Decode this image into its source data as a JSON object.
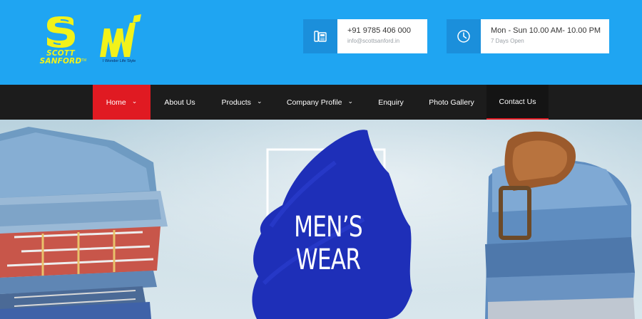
{
  "header": {
    "logo_scott": {
      "line1": "SCOTT",
      "line2": "SANFORD",
      "tm": "TM"
    },
    "logo_mw": {
      "tagline": "I Wonder Life Style"
    },
    "phone": {
      "number": "+91 9785 406 000",
      "email": "info@scottsanford.in",
      "icon": "phone-icon"
    },
    "hours": {
      "time": "Mon - Sun 10.00 AM- 10.00 PM",
      "note": "7 Days Open",
      "icon": "clock-icon"
    }
  },
  "nav": {
    "items": [
      {
        "label": "Home",
        "chev": "⌄"
      },
      {
        "label": "About Us"
      },
      {
        "label": "Products",
        "chev": "⌄"
      },
      {
        "label": "Company Profile",
        "chev": "⌄"
      },
      {
        "label": "Enquiry"
      },
      {
        "label": "Photo Gallery"
      },
      {
        "label": "Contact Us"
      }
    ]
  },
  "hero": {
    "line1": "MEN’S",
    "line2": "WEAR"
  },
  "colors": {
    "header_bg": "#1fa5f2",
    "accent": "#e01a22",
    "brand_yellow": "#f2f21a",
    "nav_bg": "#1c1c1c",
    "brush_blue": "#1e2fb8"
  }
}
